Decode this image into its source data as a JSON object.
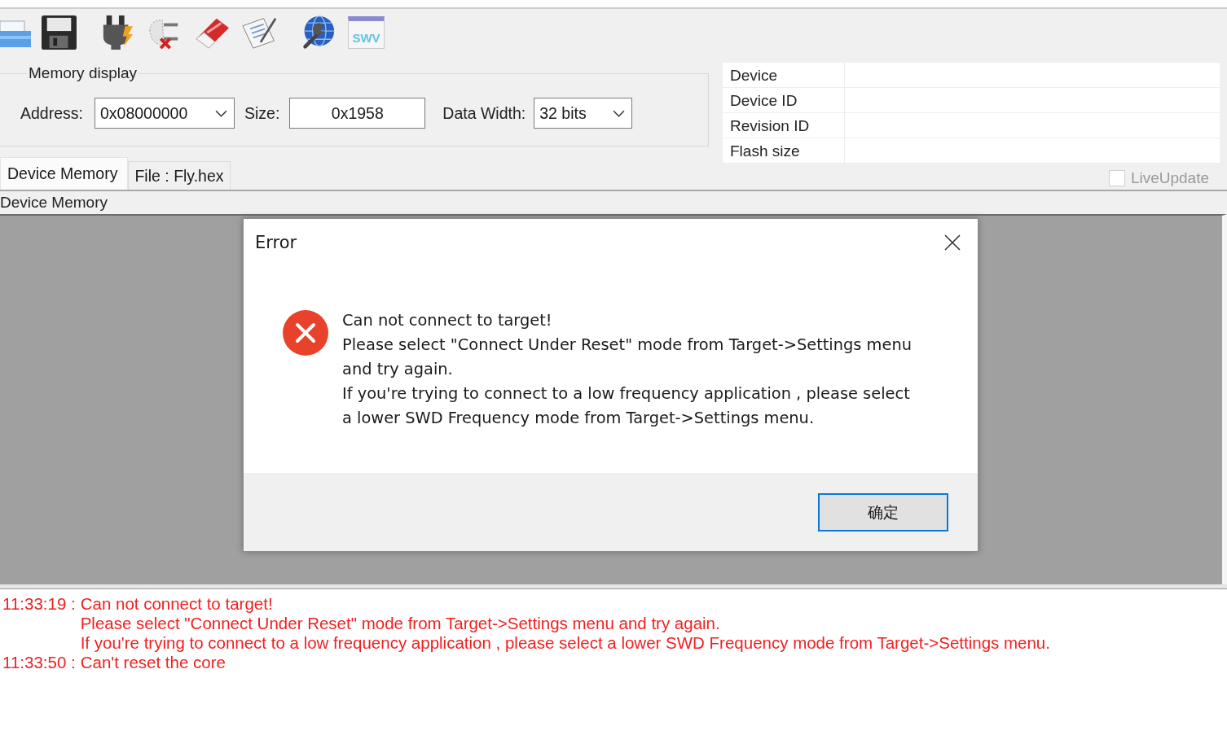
{
  "toolbar": {
    "swv_label": "SWV"
  },
  "memory_display": {
    "title": "Memory display",
    "address": {
      "label": "Address:",
      "value": "0x08000000"
    },
    "size": {
      "label": "Size:",
      "value": "0x1958"
    },
    "data_width": {
      "label": "Data Width:",
      "value": "32 bits"
    }
  },
  "device_info": [
    {
      "label": "Device"
    },
    {
      "label": "Device ID"
    },
    {
      "label": "Revision ID"
    },
    {
      "label": "Flash size"
    }
  ],
  "tabs": [
    {
      "label": "Device Memory",
      "selected": true
    },
    {
      "label": "File : Fly.hex",
      "selected": false
    }
  ],
  "live_update": {
    "label": "LiveUpdate",
    "checked": false,
    "disabled": true
  },
  "memory_pane": {
    "title": "Device Memory"
  },
  "dialog": {
    "title": "Error",
    "message": "Can not connect to target!\nPlease select \"Connect Under Reset\" mode from Target->Settings menu\nand try again.\nIf you're trying to connect to a low frequency application , please select\na lower SWD Frequency mode from Target->Settings menu.",
    "buttons": [
      {
        "label": "确定",
        "default": true
      }
    ]
  },
  "log": [
    {
      "time": "11:33:19 :",
      "message": "Can not connect to target!\nPlease select \"Connect Under Reset\" mode from Target->Settings menu and try again.\nIf you're trying to connect to a low frequency application , please select a lower SWD Frequency mode from Target->Settings menu."
    },
    {
      "time": "11:33:50 :",
      "message": "Can't reset the core"
    }
  ]
}
